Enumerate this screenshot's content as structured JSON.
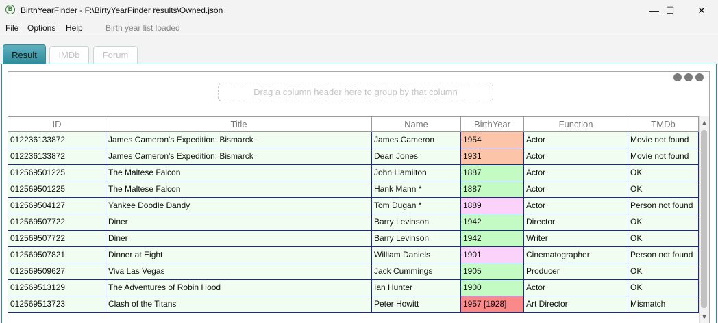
{
  "window": {
    "title": "BirthYearFinder - F:\\BirtyYearFinder results\\Owned.json",
    "app_icon_letter": "B",
    "minimize_glyph": "—",
    "maximize_glyph": "☐",
    "close_glyph": "✕"
  },
  "menu": {
    "items": [
      "File",
      "Options",
      "Help"
    ],
    "status": "Birth year list loaded"
  },
  "tabs": [
    "Result",
    "IMDb",
    "Forum"
  ],
  "active_tab": "Result",
  "grid": {
    "group_prompt": "Drag a column header here to group by that column",
    "columns": [
      "ID",
      "Title",
      "Name",
      "BirthYear",
      "Function",
      "TMDb"
    ],
    "rows": [
      [
        "012236133872",
        "James Cameron's Expedition: Bismarck",
        "James Cameron",
        "1954",
        "Actor",
        "Movie not found"
      ],
      [
        "012236133872",
        "James Cameron's Expedition: Bismarck",
        "Dean Jones",
        "1931",
        "Actor",
        "Movie not found"
      ],
      [
        "012569501225",
        "The Maltese Falcon",
        "John Hamilton",
        "1887",
        "Actor",
        "OK"
      ],
      [
        "012569501225",
        "The Maltese Falcon",
        "Hank Mann *",
        "1887",
        "Actor",
        "OK"
      ],
      [
        "012569504127",
        "Yankee Doodle Dandy",
        "Tom Dugan *",
        "1889",
        "Actor",
        "Person not found"
      ],
      [
        "012569507722",
        "Diner",
        "Barry Levinson",
        "1942",
        "Director",
        "OK"
      ],
      [
        "012569507722",
        "Diner",
        "Barry Levinson",
        "1942",
        "Writer",
        "OK"
      ],
      [
        "012569507821",
        "Dinner at Eight",
        "William Daniels",
        "1901",
        "Cinematographer",
        "Person not found"
      ],
      [
        "012569509627",
        "Viva Las Vegas",
        "Jack Cummings",
        "1905",
        "Producer",
        "OK"
      ],
      [
        "012569513129",
        "The Adventures of Robin Hood",
        "Ian Hunter",
        "1900",
        "Actor",
        "OK"
      ],
      [
        "012569513723",
        "Clash of the Titans",
        "Peter Howitt",
        "1957 [1928]",
        "Art Director",
        "Mismatch"
      ]
    ],
    "birthyear_colors": [
      "#fcc5aa",
      "#fcc5aa",
      "#c4fbc4",
      "#c4fbc4",
      "#fad2fa",
      "#c4fbc4",
      "#c4fbc4",
      "#fad2fa",
      "#c4fbc4",
      "#c4fbc4",
      "#fa8a8a"
    ],
    "row_background": "#f0fdf0",
    "grid_line_color": "#1a2799"
  },
  "colors": {
    "accent": "#2d8a99"
  }
}
